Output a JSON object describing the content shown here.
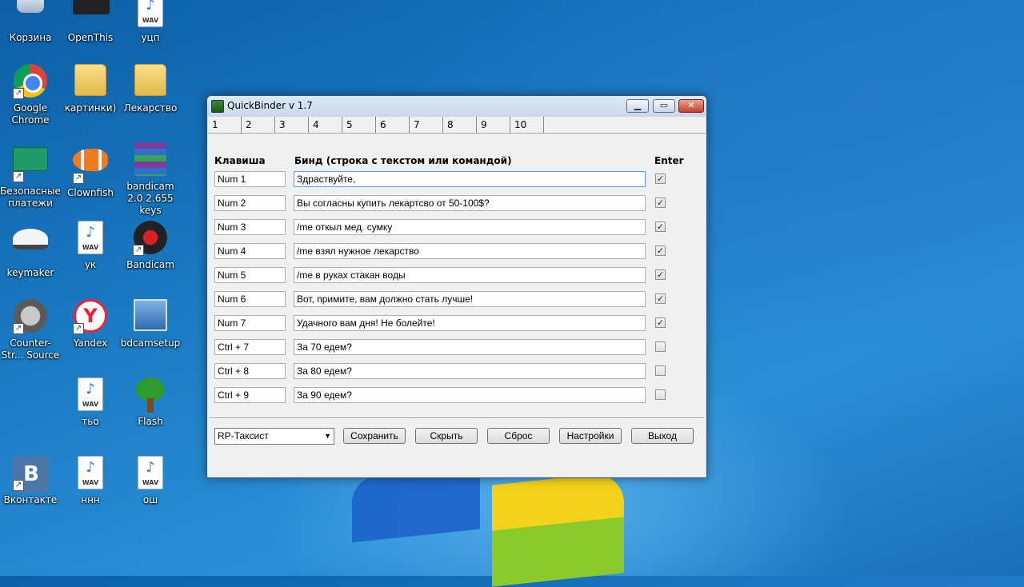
{
  "desktop": {
    "icons": [
      {
        "label": "Корзина"
      },
      {
        "label": "OpenThis"
      },
      {
        "label": "уцп"
      },
      {
        "label": "Google Chrome"
      },
      {
        "label": "картинки)"
      },
      {
        "label": "Лекарство"
      },
      {
        "label": "Безопасные платежи"
      },
      {
        "label": "Clownfish"
      },
      {
        "label": "bandicam 2.0 2.655 keys"
      },
      {
        "label": "keymaker"
      },
      {
        "label": "ук"
      },
      {
        "label": "Bandicam"
      },
      {
        "label": "Counter-Str... Source"
      },
      {
        "label": "Yandex"
      },
      {
        "label": "bdcamsetup"
      },
      {
        "label": "тьо"
      },
      {
        "label": "Flash"
      },
      {
        "label": "Вконтакте"
      },
      {
        "label": "ннн"
      },
      {
        "label": "ош"
      }
    ],
    "wav_tag": "WAV",
    "vk_letter": "B",
    "yandex_letter": "Y"
  },
  "window": {
    "title": "QuickBinder v 1.7",
    "minimize": "▁",
    "maximize": "▭",
    "close": "✕",
    "tabs": [
      "1",
      "2",
      "3",
      "4",
      "5",
      "6",
      "7",
      "8",
      "9",
      "10"
    ],
    "headers": {
      "key": "Клавиша",
      "bind": "Бинд (строка с текстом или командой)",
      "enter": "Enter"
    },
    "rows": [
      {
        "key": "Num 1",
        "bind": "Здраствуйте,",
        "enter": true
      },
      {
        "key": "Num 2",
        "bind": "Вы согласны купить лекартсво от 50-100$?",
        "enter": true
      },
      {
        "key": "Num 3",
        "bind": "/me откыл мед. сумку",
        "enter": true
      },
      {
        "key": "Num 4",
        "bind": "/me взял нужное лекарство",
        "enter": true
      },
      {
        "key": "Num 5",
        "bind": "/me в руках стакан воды",
        "enter": true
      },
      {
        "key": "Num 6",
        "bind": "Вот, примите, вам должно стать лучше!",
        "enter": true
      },
      {
        "key": "Num 7",
        "bind": "Удачного вам дня! Не болейте!",
        "enter": true
      },
      {
        "key": "Ctrl + 7",
        "bind": "За 70 едем?",
        "enter": false
      },
      {
        "key": "Ctrl + 8",
        "bind": "За 80 едем?",
        "enter": false
      },
      {
        "key": "Ctrl + 9",
        "bind": "За 90 едем?",
        "enter": false
      }
    ],
    "profile_select": "RP-Таксист",
    "buttons": {
      "save": "Сохранить",
      "hide": "Скрыть",
      "reset": "Сброс",
      "settings": "Настройки",
      "exit": "Выход"
    }
  }
}
